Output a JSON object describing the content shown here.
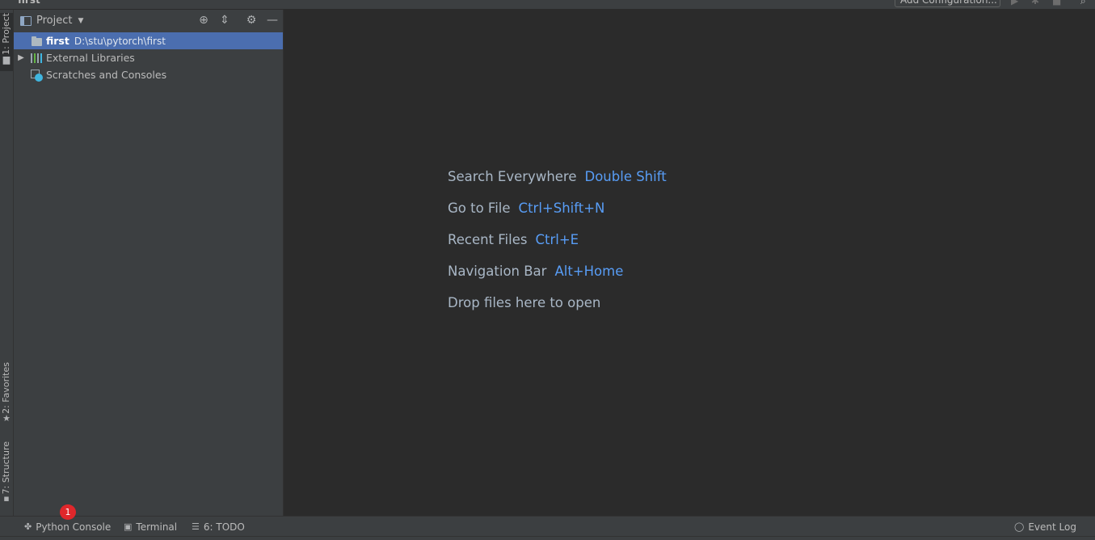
{
  "window": {
    "title": "first",
    "config_button_label": "Add Configuration..."
  },
  "left_stripe": {
    "project_tab": "1: Project",
    "favorites_tab": "2: Favorites",
    "structure_tab": "7: Structure"
  },
  "project_panel": {
    "title": "Project",
    "tree": [
      {
        "name": "first",
        "path": "D:\\stu\\pytorch\\first",
        "selected": true
      },
      {
        "name": "External Libraries",
        "path": ""
      },
      {
        "name": "Scratches and Consoles",
        "path": ""
      }
    ]
  },
  "editor_hints": [
    {
      "label": "Search Everywhere",
      "key": "Double Shift"
    },
    {
      "label": "Go to File",
      "key": "Ctrl+Shift+N"
    },
    {
      "label": "Recent Files",
      "key": "Ctrl+E"
    },
    {
      "label": "Navigation Bar",
      "key": "Alt+Home"
    },
    {
      "label": "Drop files here to open",
      "key": ""
    }
  ],
  "bottom_bar": {
    "python_console": "Python Console",
    "terminal": "Terminal",
    "todo": "6: TODO",
    "event_log": "Event Log",
    "notification_count": "1"
  },
  "colors": {
    "accent_blue": "#589df6",
    "selection": "#4b6eaf",
    "badge_red": "#e0272b"
  }
}
